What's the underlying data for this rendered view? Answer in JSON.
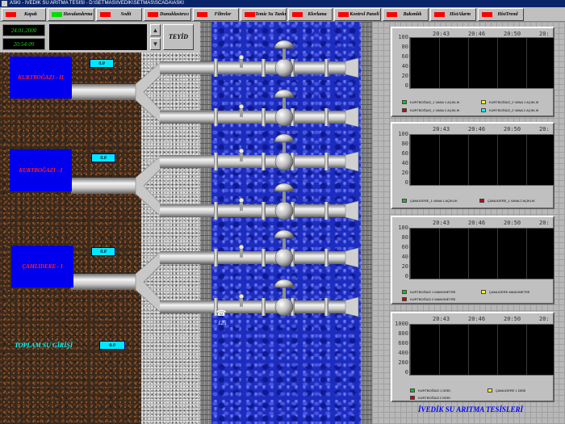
{
  "window": {
    "title": "ASKI - İVEDİK SU ARITMA TESİSİ - D:\\SETMAS\\İVEDİK\\SETMAS\\SCADA\\ASKI"
  },
  "nav": [
    {
      "label": "Kapak",
      "led": "#ff0000"
    },
    {
      "label": "Havalandırma",
      "led": "#00dd00"
    },
    {
      "label": "Sodit",
      "led": "#ff0000"
    },
    {
      "label": "Dunuklastırıcı",
      "led": "#ff0000"
    },
    {
      "label": "Filtreler",
      "led": "#ff0000"
    },
    {
      "label": "Temiz Su Tankı",
      "led": "#ff0000"
    },
    {
      "label": "Klorlama",
      "led": "#ff0000"
    },
    {
      "label": "Kontrol Paneli",
      "led": "#ff0000"
    },
    {
      "label": "Bakımlık",
      "led": "#ff0000"
    },
    {
      "label": "HistAlarm",
      "led": "#ff0000"
    },
    {
      "label": "HistTrend",
      "led": "#ff0000"
    }
  ],
  "clock": {
    "date": "24.01.2000",
    "time": "20:54:09"
  },
  "teyid_label": "TEYİD",
  "arrows": {
    "up": "▲",
    "down": "▼"
  },
  "sources": [
    {
      "name": "KURTBOĞAZI - II",
      "flow": "0.0"
    },
    {
      "name": "KURTBOĞAZI - I",
      "flow": "0.0"
    },
    {
      "name": "ÇAMLIDERE - I",
      "flow": "0.0"
    }
  ],
  "total": {
    "label": "TOPLAM SU GİRİŞİ",
    "value": "0.0"
  },
  "phone": {
    "icon": "☎",
    "number": "125"
  },
  "trends": [
    {
      "times": [
        "20:43",
        "20:46",
        "20:50",
        "20:"
      ],
      "yticks": [
        "100",
        "80",
        "60",
        "40",
        "20",
        "0"
      ],
      "legend": [
        {
          "label": "KURTBOĞAZI_1 VANA 1 AÇIKLIK",
          "color": "#00cc00"
        },
        {
          "label": "KURTBOĞAZI_2 VANA 1 AÇIKLIK",
          "color": "#ffff00"
        },
        {
          "label": "KURTBOĞAZI_1 VANA 2 AÇIKLIK",
          "color": "#cc0000"
        },
        {
          "label": "KURTBOĞAZI_2 VANA 2 AÇIKLIK",
          "color": "#00ffff"
        }
      ]
    },
    {
      "times": [
        "20:43",
        "20:46",
        "20:50",
        "20:"
      ],
      "yticks": [
        "100",
        "80",
        "60",
        "40",
        "20",
        "0"
      ],
      "legend": [
        {
          "label": "ÇAMLIDERE_1 VANA 1 AÇIKLIK",
          "color": "#00cc00"
        },
        {
          "label": "ÇAMLIDERE_1 VANA 2 AÇIKLIK",
          "color": "#cc0000"
        }
      ]
    },
    {
      "times": [
        "20:43",
        "20:46",
        "20:50",
        "20:"
      ],
      "yticks": [
        "100",
        "80",
        "60",
        "40",
        "20",
        "0"
      ],
      "legend": [
        {
          "label": "KURTBOĞAZI 1 MANOMETRE",
          "color": "#00cc00"
        },
        {
          "label": "ÇAMLIDERE MANOMETRE",
          "color": "#ffff00"
        },
        {
          "label": "KURTBOĞAZI 2 MANOMETRE",
          "color": "#cc0000"
        }
      ]
    },
    {
      "times": [
        "20:43",
        "20:46",
        "20:50",
        "20:"
      ],
      "yticks": [
        "1000",
        "800",
        "600",
        "400",
        "200",
        "0"
      ],
      "legend": [
        {
          "label": "KURTBOĞAZI 1 DEBİ",
          "color": "#00cc00"
        },
        {
          "label": "ÇAMLIDERE 1 DEBİ",
          "color": "#ffff00"
        },
        {
          "label": "KURTBOĞAZI 2 DEBİ",
          "color": "#cc0000"
        }
      ]
    }
  ],
  "footer": "İVEDİK SU ARITMA TESİSLERİ"
}
